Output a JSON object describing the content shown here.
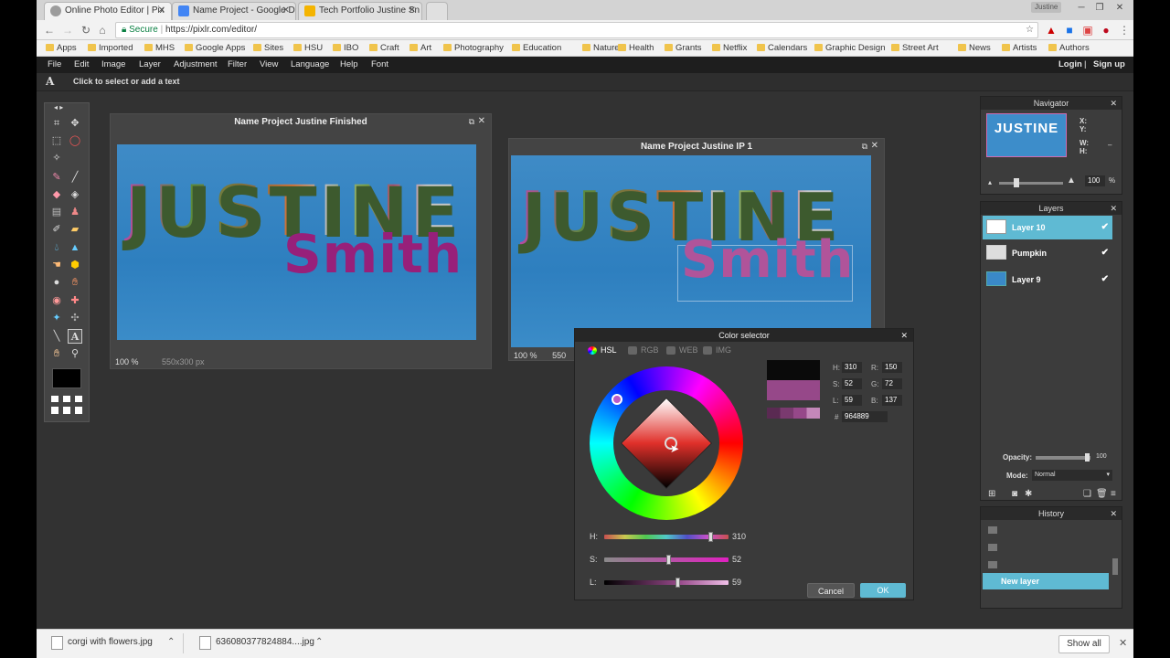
{
  "browser": {
    "tabs": [
      {
        "title": "Online Photo Editor | Pix",
        "active": true
      },
      {
        "title": "Name Project - Google D",
        "active": false
      },
      {
        "title": "Tech Portfolio Justine Sn",
        "active": false
      }
    ],
    "user_badge": "Justine",
    "secure_label": "Secure",
    "url": "https://pixlr.com/editor/",
    "bookmarks": [
      "Apps",
      "Imported",
      "MHS",
      "Google Apps",
      "Sites",
      "HSU",
      "IBO",
      "Craft",
      "Art",
      "Photography",
      "Education",
      "Nature",
      "Health",
      "Grants",
      "Netflix",
      "Calendars",
      "Graphic Design",
      "Street Art",
      "News",
      "Artists",
      "Authors"
    ]
  },
  "pixlr": {
    "menu": [
      "File",
      "Edit",
      "Image",
      "Layer",
      "Adjustment",
      "Filter",
      "View",
      "Language",
      "Help",
      "Font"
    ],
    "login": "Login",
    "separator": "|",
    "signup": "Sign up",
    "tool_glyph": "A",
    "tool_hint": "Click to select or add a text",
    "doc1": {
      "title": "Name Project Justine Finished",
      "zoom": "100",
      "zoom_unit": "%",
      "size": "550x300 px",
      "headline": "JUSTINE",
      "name": "Smith"
    },
    "doc2": {
      "title": "Name Project Justine IP 1",
      "zoom": "100",
      "zoom_unit": "%",
      "zoom_tail": "550",
      "headline": "JUSTINE",
      "name": "Smith"
    },
    "navigator": {
      "title": "Navigator",
      "x": "X:",
      "y": "Y:",
      "w": "W:",
      "h": "H:",
      "dash": "–",
      "zoom": "100",
      "zoom_unit": "%",
      "thumb_text": "JUSTINE"
    },
    "layers": {
      "title": "Layers",
      "items": [
        {
          "name": "Layer 10",
          "selected": true
        },
        {
          "name": "Pumpkin",
          "selected": false
        },
        {
          "name": "Layer 9",
          "selected": false
        }
      ],
      "opacity_label": "Opacity:",
      "opacity": "100",
      "mode_label": "Mode:",
      "mode": "Normal"
    },
    "history": {
      "title": "History",
      "current": "New layer"
    }
  },
  "color_selector": {
    "title": "Color selector",
    "tabs": [
      "HSL",
      "RGB",
      "WEB",
      "IMG"
    ],
    "fields": {
      "H": "310",
      "S": "52",
      "L": "59",
      "R": "150",
      "G": "72",
      "B": "137"
    },
    "hex_label": "#",
    "hex": "964889",
    "sliders": [
      {
        "label": "H:",
        "value": "310"
      },
      {
        "label": "S:",
        "value": "52"
      },
      {
        "label": "L:",
        "value": "59"
      }
    ],
    "cancel": "Cancel",
    "ok": "OK",
    "swatch_old": "#0a0a0a",
    "swatch_new": "#964889"
  },
  "downloads": {
    "items": [
      "corgi with flowers.jpg",
      "636080377824884....jpg"
    ],
    "show_all": "Show all"
  }
}
